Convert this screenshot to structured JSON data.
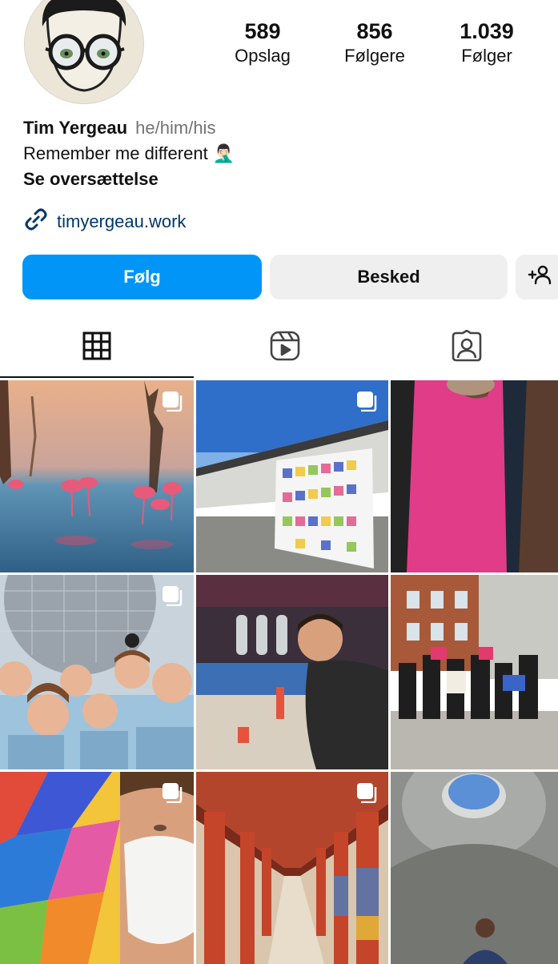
{
  "profile": {
    "name": "Tim Yergeau",
    "pronouns": "he/him/his",
    "bio": "Remember me different 🤦🏻‍♂️",
    "translate": "Se oversættelse",
    "link": "timyergeau.work"
  },
  "stats": [
    {
      "value": "589",
      "label": "Opslag"
    },
    {
      "value": "856",
      "label": "Følgere"
    },
    {
      "value": "1.039",
      "label": "Følger"
    }
  ],
  "actions": {
    "follow": "Følg",
    "message": "Besked",
    "add_user_icon": "person-plus-icon"
  },
  "tabs": [
    {
      "icon": "grid-icon",
      "active": true
    },
    {
      "icon": "reels-icon",
      "active": false
    },
    {
      "icon": "tagged-icon",
      "active": false
    }
  ],
  "posts": [
    {
      "subject": "flamingos-lake",
      "multi": true
    },
    {
      "subject": "building-banner-wall",
      "multi": true
    },
    {
      "subject": "bans-off-our-bodies-shirt",
      "multi": false
    },
    {
      "subject": "group-selfie-epcot",
      "multi": true
    },
    {
      "subject": "man-at-bar",
      "multi": false
    },
    {
      "subject": "protest-crowd",
      "multi": false
    },
    {
      "subject": "masked-selfie-balloon",
      "multi": true
    },
    {
      "subject": "red-colonnade",
      "multi": true
    },
    {
      "subject": "skyspace-oculus",
      "multi": false
    }
  ],
  "colors": {
    "primary_blue": "#0095f6",
    "secondary_gray": "#efefef",
    "link_blue": "#00376b"
  }
}
